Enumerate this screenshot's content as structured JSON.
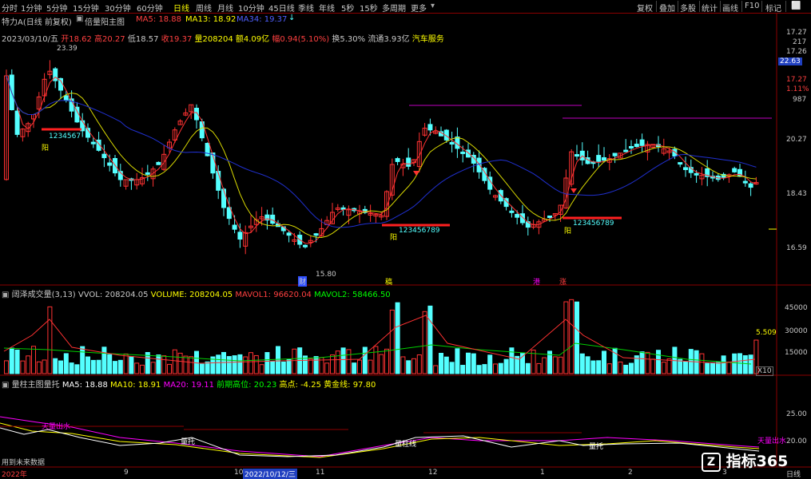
{
  "toolbar": {
    "stock_name": "特力A",
    "tabs": [
      "分时",
      "1分钟",
      "5分钟",
      "15分钟",
      "30分钟",
      "60分钟",
      "日线",
      "周线",
      "月线",
      "10分钟",
      "45日线",
      "季线",
      "年线",
      "5秒",
      "15秒",
      "多周期",
      "更多"
    ],
    "active_tab": "日线",
    "right_tabs": [
      "复权",
      "叠加",
      "多股",
      "统计",
      "画线",
      "F10",
      "标记"
    ]
  },
  "main_panel": {
    "title_prefix": "特力A(日线 前复权)",
    "indicator": "倍量阳主图",
    "ma5": "MA5: 18.88",
    "ma13": "MA13: 18.92",
    "ma34": "MA34: 19.37",
    "date": "2023/03/10/五",
    "open": "开18.62",
    "high": "高20.27",
    "low": "低18.57",
    "close": "收19.37",
    "volume": "量208204",
    "amount": "额4.09亿",
    "change": "幅0.94(5.10%)",
    "turnover": "换5.30%",
    "float_cap": "流通3.93亿",
    "sector": "汽车服务",
    "high_label": "23.39",
    "low_label": "15.80",
    "yang_label": "阳",
    "seq_1": "1234567",
    "seq_2": "123456789",
    "seq_3": "123456789",
    "event_cai": "财",
    "event_gao": "稿",
    "event_gang": "港",
    "event_zhang": "涨"
  },
  "main_yaxis": [
    "17.27",
    "217",
    "17.26",
    "22.63",
    "17.27",
    "1.11%",
    "987",
    "20.27",
    "18.43",
    "16.59"
  ],
  "vol_panel": {
    "title": "阔泽成交量(3,13)",
    "vvol": "VVOL: 208204.05",
    "volume": "VOLUME: 208204.05",
    "mavol1": "MAVOL1: 96620.04",
    "mavol2": "MAVOL2: 58466.50",
    "yaxis": [
      "45000",
      "30000",
      "15000"
    ],
    "current": "5.509",
    "unit": "X10"
  },
  "sub_panel": {
    "title": "量柱主图量托",
    "ma5": "MA5: 18.88",
    "ma10": "MA10: 18.91",
    "ma20": "MA20: 19.11",
    "prev_high": "前期高位: 20.23",
    "high_point": "高点: -4.25",
    "gold_line": "黄金线: 97.80",
    "yaxis": [
      "25.00",
      "20.00"
    ],
    "labels": [
      "天量出水",
      "量托",
      "量托",
      "天量出水"
    ],
    "red_label": "量柱线",
    "future_note": "用到未来数据"
  },
  "xaxis": {
    "labels": [
      "2022年",
      "9",
      "10",
      "2022/10/12/三",
      "11",
      "12",
      "1",
      "2",
      "3"
    ],
    "period": "日线"
  },
  "watermark": "指标365",
  "colors": {
    "up": "#ff3232",
    "down": "#54ffff",
    "ma5": "#ffffff",
    "ma13": "#ffff00",
    "ma34": "#2030d0",
    "purple": "#c000c0",
    "bg": "#000000"
  }
}
